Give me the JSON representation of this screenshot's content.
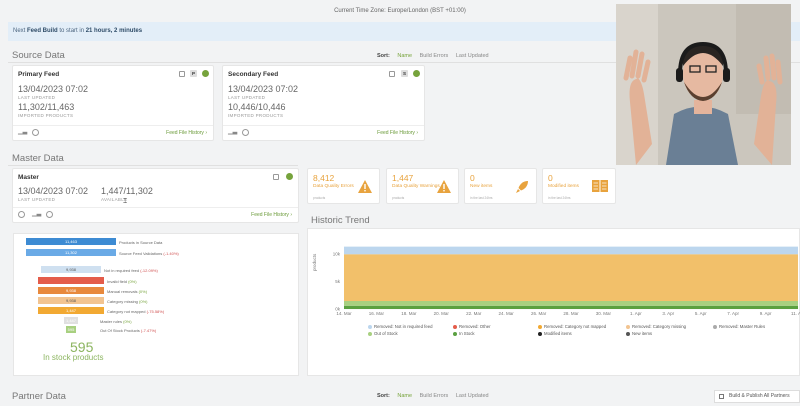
{
  "topbar": {
    "timezone": "Current Time Zone: Europe/London (BST +01:00)"
  },
  "notice": {
    "prefix": "Next",
    "bold1": "Feed Build",
    "middle": "to start in",
    "bold2": "21 hours, 2 minutes"
  },
  "source_data": {
    "title": "Source Data",
    "sort_label": "Sort:",
    "sort_options": [
      "Name",
      "Build Errors",
      "Last Updated"
    ],
    "primary": {
      "title": "Primary Feed",
      "badge": "P",
      "date": "13/04/2023 07:02",
      "last_updated": "LAST UPDATED",
      "products": "11,302/11,463",
      "imported": "IMPORTED PRODUCTS",
      "history": "Feed File History"
    },
    "secondary": {
      "title": "Secondary Feed",
      "badge": "S",
      "date": "13/04/2023 07:02",
      "last_updated": "LAST UPDATED",
      "products": "10,446/10,446",
      "imported": "IMPORTED PRODUCTS",
      "history": "Feed File History"
    }
  },
  "master_data": {
    "title": "Master Data",
    "master": {
      "title": "Master",
      "date": "13/04/2023 07:02",
      "last_updated": "LAST UPDATED",
      "products": "1,447/11,302",
      "available": "AVAILABLE",
      "history": "Feed File History"
    },
    "stats": [
      {
        "value": "8,412",
        "label": "Data Quality Errors",
        "sub": "products",
        "icon": "warning-icon"
      },
      {
        "value": "1,447",
        "label": "Data Quality Warnings",
        "sub": "products",
        "icon": "warning-icon"
      },
      {
        "value": "0",
        "label": "New items",
        "sub": "in the last 24hrs",
        "icon": "rocket-icon"
      },
      {
        "value": "0",
        "label": "Modified items",
        "sub": "in the last 24hrs",
        "icon": "book-icon"
      }
    ]
  },
  "funnel": {
    "stages": [
      {
        "value": "11,463",
        "label": "Products in Source Data",
        "pct": "",
        "color": "#3d8bd3"
      },
      {
        "value": "11,302",
        "label": "Source Feed Validations",
        "pct": "(-1.40%)",
        "color": "#6aaae6"
      },
      {
        "value": "9,938",
        "label": "Not in required feed",
        "pct": "(-12.09%)",
        "color": "#cfe0f0"
      },
      {
        "value": "",
        "label": "Invalid field",
        "pct": "(0%)",
        "color": "#e45c4a"
      },
      {
        "value": "9,938",
        "label": "Manual removals",
        "pct": "(0%)",
        "color": "#e8893d"
      },
      {
        "value": "9,938",
        "label": "Category missing",
        "pct": "(0%)",
        "color": "#f2c491"
      },
      {
        "value": "1,447",
        "label": "Category not mapped",
        "pct": "(-75.58%)",
        "color": "#f2a932"
      },
      {
        "value": "1,447",
        "label": "Master rules",
        "pct": "(0%)",
        "color": "#e0e0e0"
      },
      {
        "value": "595",
        "label": "Out Of Stock Products",
        "pct": "(-7.47%)",
        "color": "#a8d080"
      }
    ],
    "instock_value": "595",
    "instock_label": "In stock products"
  },
  "trend": {
    "title": "Historic Trend",
    "ylabel": "products",
    "yticks": [
      "10k",
      "5k",
      "0k"
    ],
    "xticks": [
      "14. Mar",
      "16. Mar",
      "18. Mar",
      "20. Mar",
      "22. Mar",
      "24. Mar",
      "26. Mar",
      "28. Mar",
      "30. Mar",
      "1. Apr",
      "3. Apr",
      "5. Apr",
      "7. Apr",
      "9. Apr",
      "11. Apr"
    ],
    "legend": [
      {
        "label": "Removed: Not in required feed",
        "color": "#bcd6ee"
      },
      {
        "label": "Removed: Other",
        "color": "#e45c4a"
      },
      {
        "label": "Removed: Category not mapped",
        "color": "#f2a932"
      },
      {
        "label": "Removed: Category missing",
        "color": "#f2c491"
      },
      {
        "label": "Removed: Master Rules",
        "color": "#aaaaaa"
      },
      {
        "label": "Out of Stock",
        "color": "#a8d080"
      },
      {
        "label": "In Stock",
        "color": "#5aa040"
      },
      {
        "label": "Modified items",
        "color": "#222222"
      },
      {
        "label": "New items",
        "color": "#555555"
      }
    ]
  },
  "partner_data": {
    "title": "Partner Data",
    "sort_label": "Sort:",
    "sort_options": [
      "Name",
      "Build Errors",
      "Last Updated"
    ],
    "button": "Build & Publish All Partners"
  },
  "chart_data": {
    "type": "area",
    "title": "Historic Trend",
    "xlabel": "",
    "ylabel": "products",
    "x": [
      "14. Mar",
      "16. Mar",
      "18. Mar",
      "20. Mar",
      "22. Mar",
      "24. Mar",
      "26. Mar",
      "28. Mar",
      "30. Mar",
      "1. Apr",
      "3. Apr",
      "5. Apr",
      "7. Apr",
      "9. Apr",
      "11. Apr"
    ],
    "ylim": [
      0,
      12000
    ],
    "grid": true,
    "legend": "bottom",
    "series": [
      {
        "name": "In Stock",
        "values": [
          600,
          600,
          600,
          600,
          600,
          600,
          600,
          600,
          600,
          600,
          600,
          600,
          600,
          600,
          600
        ]
      },
      {
        "name": "Out of Stock",
        "values": [
          850,
          850,
          850,
          850,
          850,
          850,
          850,
          850,
          850,
          850,
          850,
          850,
          850,
          850,
          850
        ]
      },
      {
        "name": "Removed: Category not mapped",
        "values": [
          8500,
          8500,
          8500,
          8500,
          8500,
          8500,
          8500,
          8500,
          8500,
          8500,
          8500,
          8500,
          8500,
          8500,
          8500
        ]
      },
      {
        "name": "Removed: Not in required feed",
        "values": [
          1400,
          1400,
          1400,
          1400,
          1400,
          1400,
          1400,
          1400,
          1400,
          1400,
          1400,
          1400,
          1400,
          1400,
          1400
        ]
      }
    ]
  }
}
